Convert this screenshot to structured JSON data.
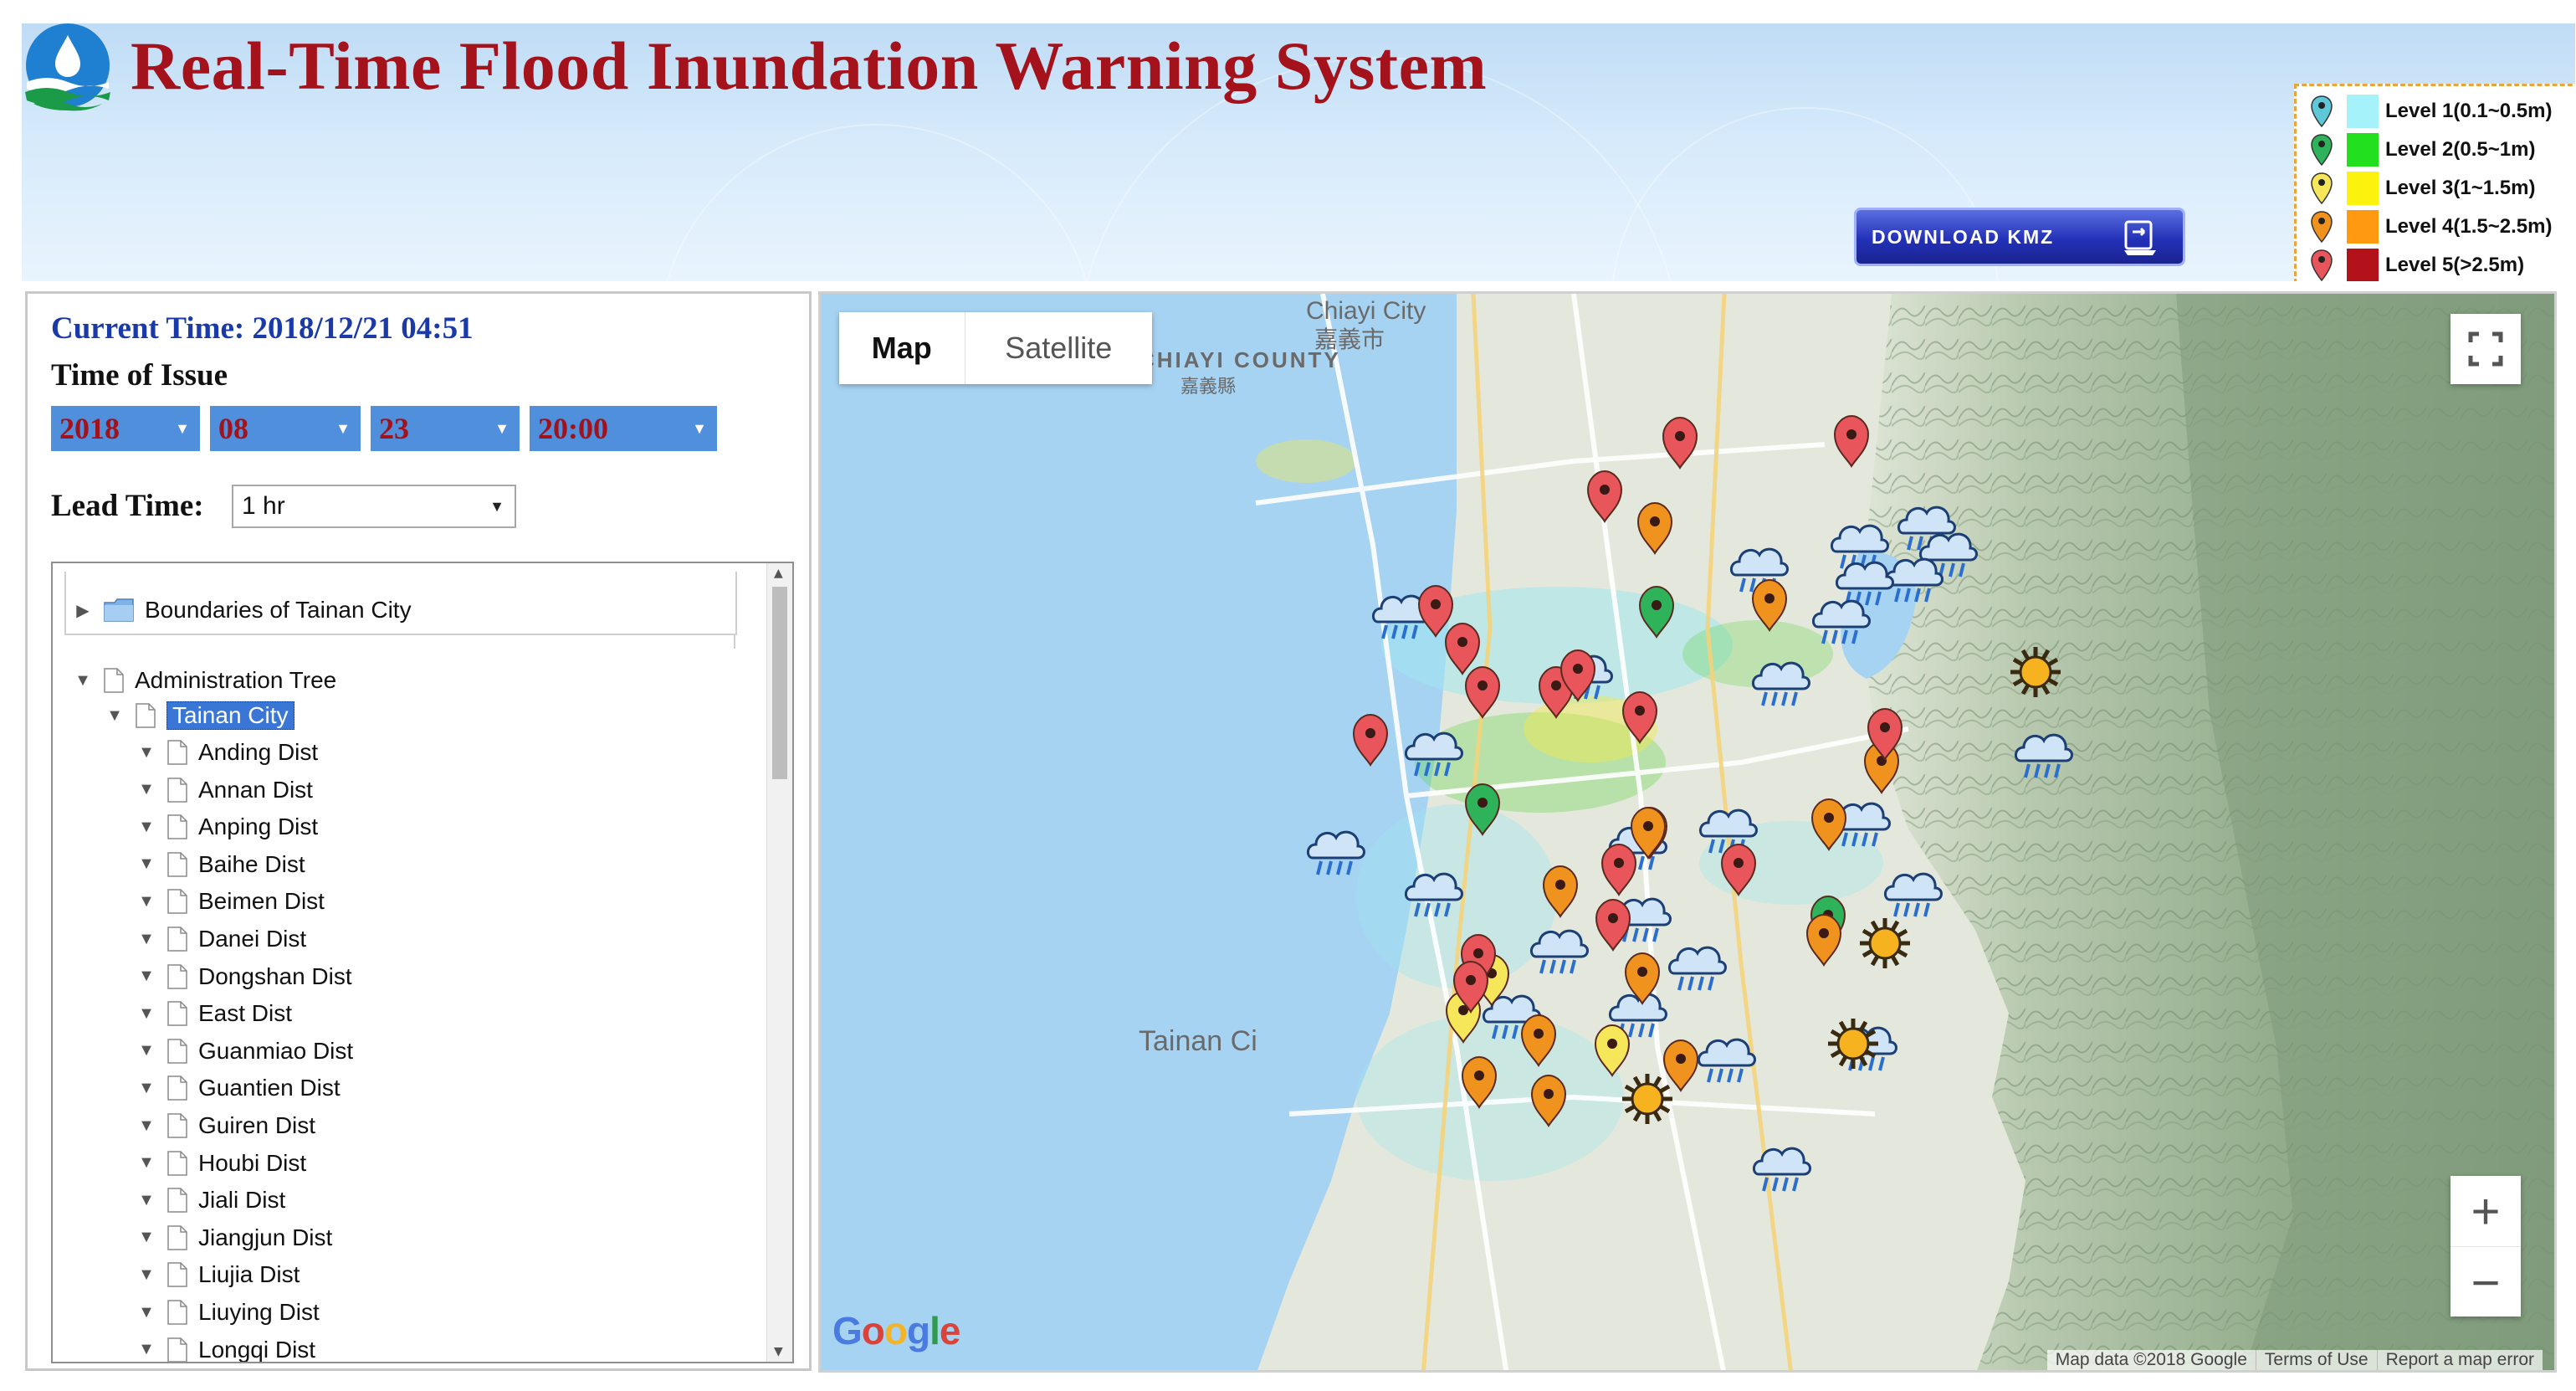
{
  "app": {
    "title": "Real-Time Flood Inundation Warning System",
    "download_label": "DOWNLOAD KMZ"
  },
  "legend": [
    {
      "label": "Level 1(0.1~0.5m)",
      "pin_color": "#5ec7d8",
      "swatch_color": "#a6f2fb"
    },
    {
      "label": "Level 2(0.5~1m)",
      "pin_color": "#2fb35a",
      "swatch_color": "#22e01e"
    },
    {
      "label": "Level 3(1~1.5m)",
      "pin_color": "#f6e65a",
      "swatch_color": "#fbf20d"
    },
    {
      "label": "Level 4(1.5~2.5m)",
      "pin_color": "#f0921e",
      "swatch_color": "#ff9a10"
    },
    {
      "label": "Level 5(>2.5m)",
      "pin_color": "#e8555a",
      "swatch_color": "#b3121a"
    }
  ],
  "controls": {
    "current_time": "Current Time: 2018/12/21 04:51",
    "time_of_issue_label": "Time of Issue",
    "year": "2018",
    "month": "08",
    "day": "23",
    "hour": "20:00",
    "lead_time_label": "Lead Time:",
    "lead_time_value": "1 hr"
  },
  "tree": {
    "boundaries_label": "Boundaries of Tainan City",
    "admin_label": "Administration Tree",
    "city_label": "Tainan City",
    "districts": [
      "Anding Dist",
      "Annan Dist",
      "Anping Dist",
      "Baihe Dist",
      "Beimen Dist",
      "Danei Dist",
      "Dongshan Dist",
      "East Dist",
      "Guanmiao Dist",
      "Guantien Dist",
      "Guiren Dist",
      "Houbi Dist",
      "Jiali Dist",
      "Jiangjun Dist",
      "Liujia Dist",
      "Liuying Dist",
      "Longqi Dist"
    ]
  },
  "map": {
    "map_button": "Map",
    "satellite_button": "Satellite",
    "google_text": "Google",
    "attribution": "Map data ©2018 Google",
    "terms": "Terms of Use",
    "report": "Report a map error",
    "places": {
      "chiayi_city_en": "Chiayi City",
      "chiayi_city_zh": "嘉義市",
      "chiayi_county_en": "CHIAYI COUNTY",
      "chiayi_county_zh": "嘉義縣",
      "tainan_partial": "Tainan Ci"
    },
    "colors": {
      "sea": "#a7d3f3",
      "land": "#e4e8dc",
      "mountain": "#9fb89a",
      "flood_level_1": "#9ee6ef",
      "flood_level_2": "#63d34a",
      "flood_level_3": "#f2e94a"
    },
    "markers": {
      "red": [
        [
          2005,
          532
        ],
        [
          1915,
          596
        ],
        [
          1713,
          733
        ],
        [
          1745,
          778
        ],
        [
          1769,
          830
        ],
        [
          1857,
          830
        ],
        [
          1883,
          810
        ],
        [
          1957,
          860
        ],
        [
          1635,
          887
        ],
        [
          1932,
          1042
        ],
        [
          2075,
          1042
        ],
        [
          1925,
          1108
        ],
        [
          1764,
          1150
        ],
        [
          1755,
          1182
        ],
        [
          2250,
          880
        ],
        [
          2210,
          530
        ]
      ],
      "orange": [
        [
          1975,
          634
        ],
        [
          2112,
          726
        ],
        [
          1967,
          998
        ],
        [
          1862,
          1068
        ],
        [
          2183,
          988
        ],
        [
          1960,
          1172
        ],
        [
          1836,
          1246
        ],
        [
          1765,
          1296
        ],
        [
          1848,
          1318
        ],
        [
          2006,
          1276
        ],
        [
          2177,
          1126
        ],
        [
          2246,
          920
        ]
      ],
      "yellow": [
        [
          1780,
          1174
        ],
        [
          1746,
          1218
        ],
        [
          1924,
          1258
        ],
        [
          1969,
          998
        ]
      ],
      "green": [
        [
          1977,
          734
        ],
        [
          1769,
          970
        ],
        [
          2182,
          1104
        ]
      ],
      "rain": [
        [
          1672,
          734
        ],
        [
          2100,
          678
        ],
        [
          2220,
          650
        ],
        [
          2300,
          628
        ],
        [
          2326,
          660
        ],
        [
          2285,
          690
        ],
        [
          2226,
          694
        ],
        [
          2198,
          740
        ],
        [
          2126,
          814
        ],
        [
          1890,
          806
        ],
        [
          1711,
          898
        ],
        [
          1594,
          1016
        ],
        [
          1955,
          1010
        ],
        [
          2063,
          990
        ],
        [
          2222,
          982
        ],
        [
          2284,
          1066
        ],
        [
          1711,
          1066
        ],
        [
          1960,
          1096
        ],
        [
          1861,
          1134
        ],
        [
          2026,
          1154
        ],
        [
          1955,
          1210
        ],
        [
          1804,
          1212
        ],
        [
          2230,
          1250
        ],
        [
          2061,
          1264
        ],
        [
          2127,
          1394
        ],
        [
          2440,
          900
        ]
      ],
      "sun": [
        [
          2430,
          800
        ],
        [
          2250,
          1124
        ],
        [
          2212,
          1244
        ],
        [
          1966,
          1310
        ]
      ]
    }
  }
}
